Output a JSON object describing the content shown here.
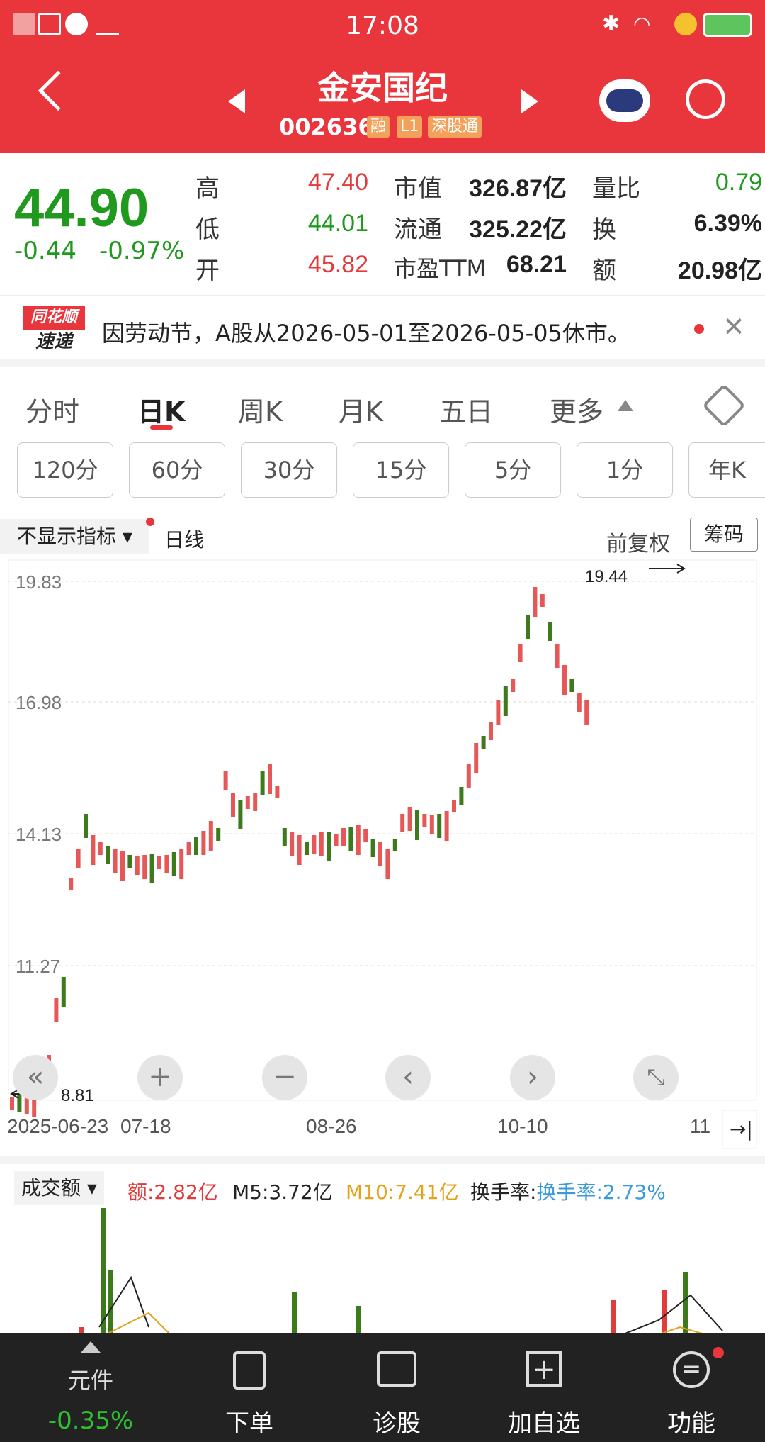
{
  "status_bar": {
    "time": "17:08"
  },
  "header": {
    "name": "金安国纪",
    "code": "002636",
    "tags": [
      "融",
      "L1",
      "深股通"
    ]
  },
  "quote": {
    "price": "44.90",
    "change": "-0.44",
    "change_pct": "-0.97%",
    "labels": {
      "high": "高",
      "low": "低",
      "open": "开",
      "mcap": "市值",
      "float": "流通",
      "pe": "市盈TTM",
      "vol_ratio": "量比",
      "turnover": "换",
      "amount": "额"
    },
    "high": "47.40",
    "low": "44.01",
    "open": "45.82",
    "mcap": "326.87亿",
    "float": "325.22亿",
    "pe": "68.21",
    "vol_ratio": "0.79",
    "turnover": "6.39%",
    "amount": "20.98亿"
  },
  "notice": {
    "badge_top": "同花顺",
    "badge_bottom": "速递",
    "text": "因劳动节，A股从2026-05-01至2026-05-05休市。"
  },
  "tabs": [
    "分时",
    "日K",
    "周K",
    "月K",
    "五日",
    "更多"
  ],
  "periods": [
    "120分",
    "60分",
    "30分",
    "15分",
    "5分",
    "1分",
    "年K"
  ],
  "chart_bar": {
    "indicator": "不显示指标",
    "line_type": "日线",
    "adjust": "前复权",
    "chips": "筹码"
  },
  "chart_data": {
    "type": "candlestick",
    "y_ticks": [
      "19.83",
      "16.98",
      "14.13",
      "11.27"
    ],
    "x_ticks": [
      "2025-06-23",
      "07-18",
      "08-26",
      "10-10",
      "11"
    ],
    "max_label": "19.44",
    "min_label": "8.81"
  },
  "volume": {
    "label": "成交额",
    "amount": "额:2.82亿",
    "m5": "M5:3.72亿",
    "m10": "M10:7.41亿",
    "turnover": "换手率:2.73%"
  },
  "bottom": {
    "item1_label": "元件",
    "item1_pct": "-0.35%",
    "items": [
      "下单",
      "诊股",
      "加自选",
      "功能"
    ]
  },
  "colors": {
    "up": "#e23b3b",
    "down": "#1f9a1f",
    "brand": "#e8363c"
  }
}
